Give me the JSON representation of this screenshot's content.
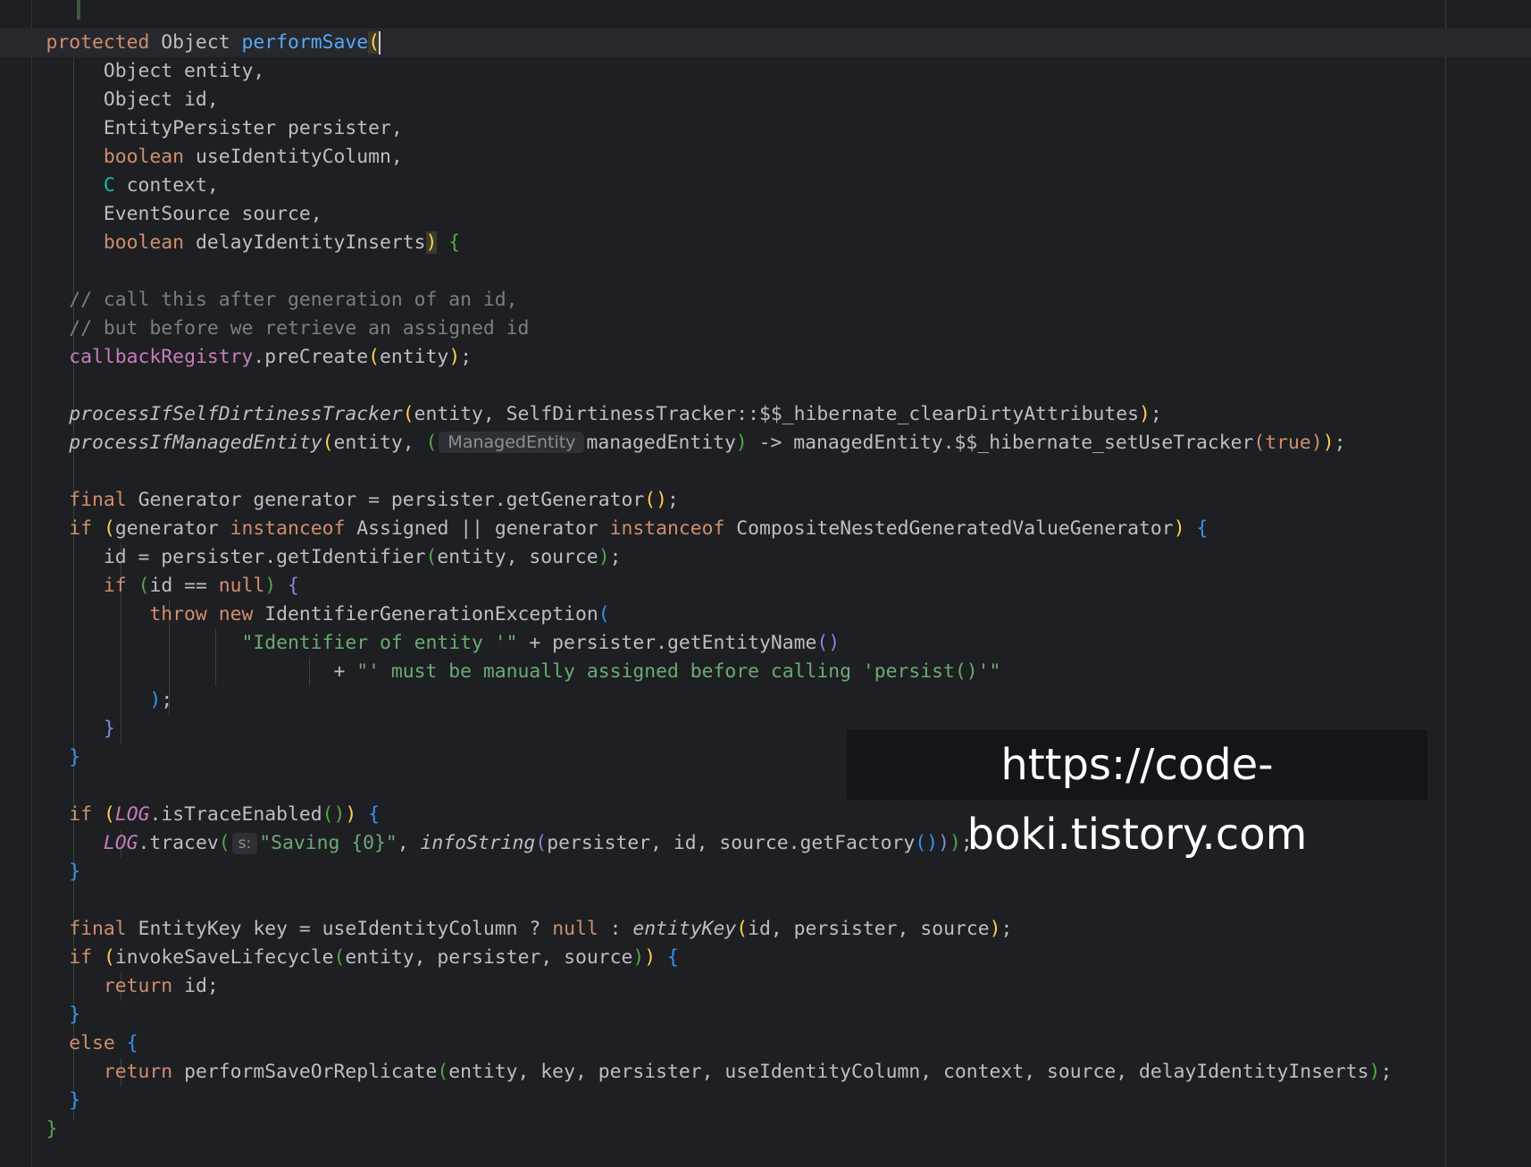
{
  "editor": {
    "hints": {
      "managed_entity_type": "ManagedEntity",
      "tracev_param": "s:"
    },
    "watermark": "https://code-boki.tistory.com",
    "lines": {
      "l00_kw": "protected",
      "l00_type": " Object ",
      "l00_fn": "performSave",
      "l01": "Object entity,",
      "l02": "Object id,",
      "l03": "EntityPersister persister,",
      "l04_kw": "boolean",
      "l04_rest": " useIdentityColumn,",
      "l05_type": "C",
      "l05_rest": " context,",
      "l06": "EventSource source,",
      "l07_kw": "boolean",
      "l07_rest": " delayIdentityInserts",
      "l09": "// call this after generation of an id,",
      "l10": "// but before we retrieve an assigned id",
      "l11_field": "callbackRegistry",
      "l11_rest": ".preCreate",
      "l11_arg": "entity",
      "l13_fn": "processIfSelfDirtinessTracker",
      "l13_args": "entity, SelfDirtinessTracker::$$_hibernate_clearDirtyAttributes",
      "l14_fn": "processIfManagedEntity",
      "l14_a": "entity, ",
      "l14_b": "managedEntity",
      "l14_c": " -> managedEntity.$$_hibernate_setUseTracker",
      "l14_true": "true",
      "l16_kw": "final",
      "l16_rest": " Generator generator = persister.getGenerator",
      "l17_if": "if",
      "l17_a": "generator ",
      "l17_inst1": "instanceof",
      "l17_b": " Assigned || generator ",
      "l17_inst2": "instanceof",
      "l17_c": " CompositeNestedGeneratedValueGenerator",
      "l18_a": "id = persister.getIdentifier",
      "l18_args": "entity, source",
      "l19_if": "if",
      "l19_a": "id == ",
      "l19_null": "null",
      "l20_throw": "throw",
      "l20_new": "new",
      "l20_rest": " IdentifierGenerationException",
      "l21_str": "\"Identifier of entity '\"",
      "l21_rest": " + persister.getEntityName",
      "l22_plus": "+ ",
      "l22_str": "\"' must be manually assigned before calling 'persist()'\"",
      "l23": ";",
      "l27_if": "if",
      "l27_log": "LOG",
      "l27_rest": ".isTraceEnabled",
      "l28_log": "LOG",
      "l28_rest": ".tracev",
      "l28_str": "\"Saving {0}\"",
      "l28_comma": ", ",
      "l28_fn": "infoString",
      "l28_args": "persister, id, source.getFactory",
      "l31_kw": "final",
      "l31_a": " EntityKey key = useIdentityColumn ? ",
      "l31_null": "null",
      "l31_b": " : ",
      "l31_fn": "entityKey",
      "l31_args": "id, persister, source",
      "l32_if": "if",
      "l32_a": "invokeSaveLifecycle",
      "l32_args": "entity, persister, source",
      "l33_kw": "return",
      "l33_rest": " id;",
      "l35_else": "else",
      "l36_kw": "return",
      "l36_rest": " performSaveOrReplicate",
      "l36_args": "entity, key, persister, useIdentityColumn, context, source, delayIdentityInserts"
    }
  }
}
